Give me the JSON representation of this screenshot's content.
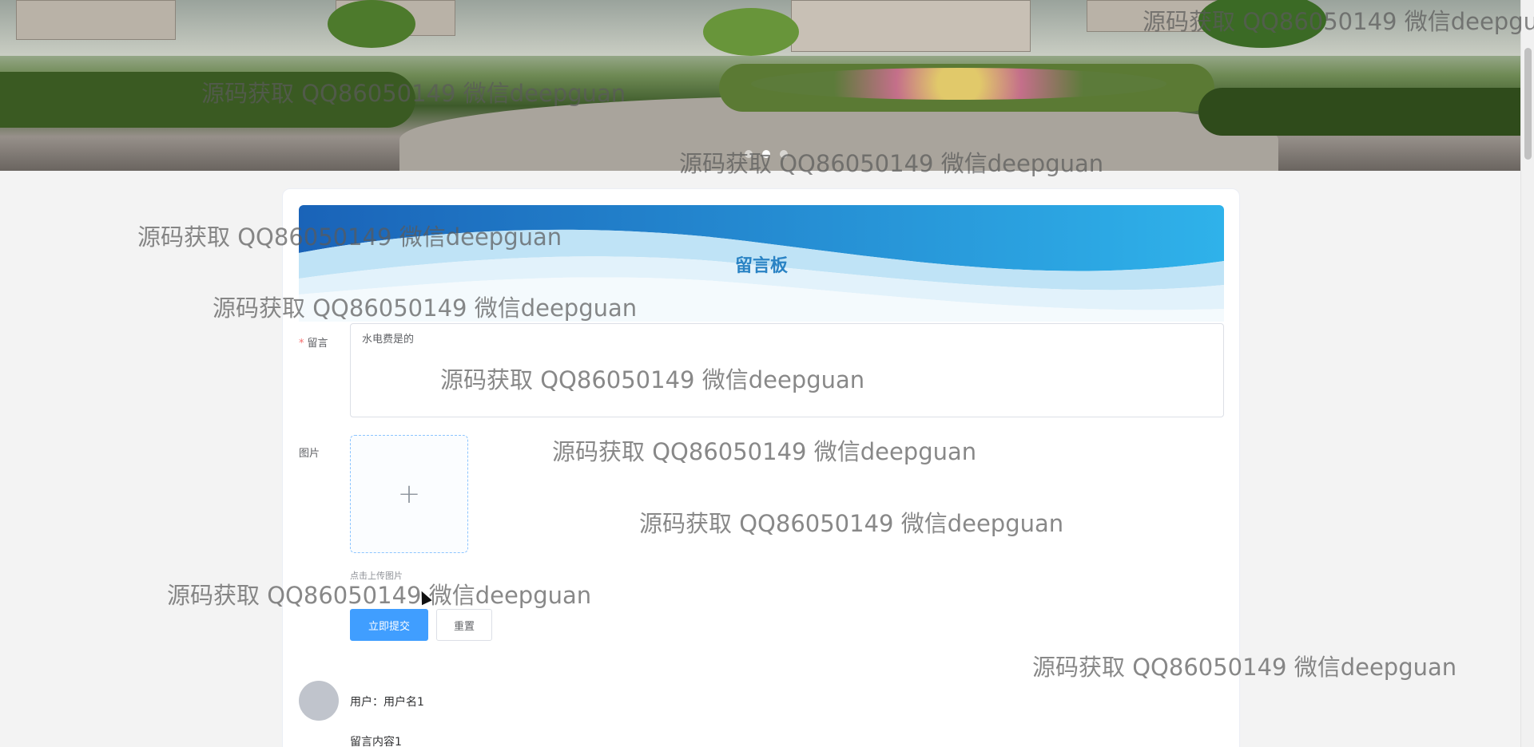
{
  "banner": {
    "slides": 3,
    "active_slide": 1
  },
  "board": {
    "title": "留言板"
  },
  "form": {
    "message_label": "留言",
    "message_value": "水电费是的",
    "image_label": "图片",
    "upload_icon": "+",
    "upload_tip": "点击上传图片",
    "submit_label": "立即提交",
    "reset_label": "重置"
  },
  "comments": [
    {
      "user": "用户：用户名1",
      "content": "留言内容1"
    }
  ],
  "watermark": {
    "text": "源码获取 QQ86050149 微信deepguan"
  },
  "colors": {
    "primary": "#409eff",
    "title": "#2a83c4",
    "required": "#f56c6c",
    "wave_dark": "#1f8fd6",
    "wave_light": "#9fd7f2"
  }
}
